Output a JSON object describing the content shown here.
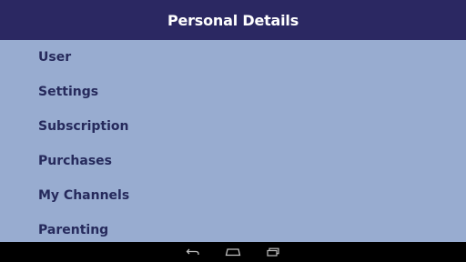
{
  "header": {
    "title": "Personal Details"
  },
  "menu": {
    "items": [
      {
        "label": "User"
      },
      {
        "label": "Settings"
      },
      {
        "label": "Subscription"
      },
      {
        "label": "Purchases"
      },
      {
        "label": "My Channels"
      },
      {
        "label": "Parenting"
      }
    ]
  },
  "navbar": {
    "back_icon": "back-arrow-icon",
    "home_icon": "home-icon",
    "recents_icon": "recent-apps-icon"
  },
  "colors": {
    "header_bg": "#2b2862",
    "content_bg": "#98acd0",
    "menu_text": "#262a5c",
    "navbar_bg": "#000000"
  }
}
